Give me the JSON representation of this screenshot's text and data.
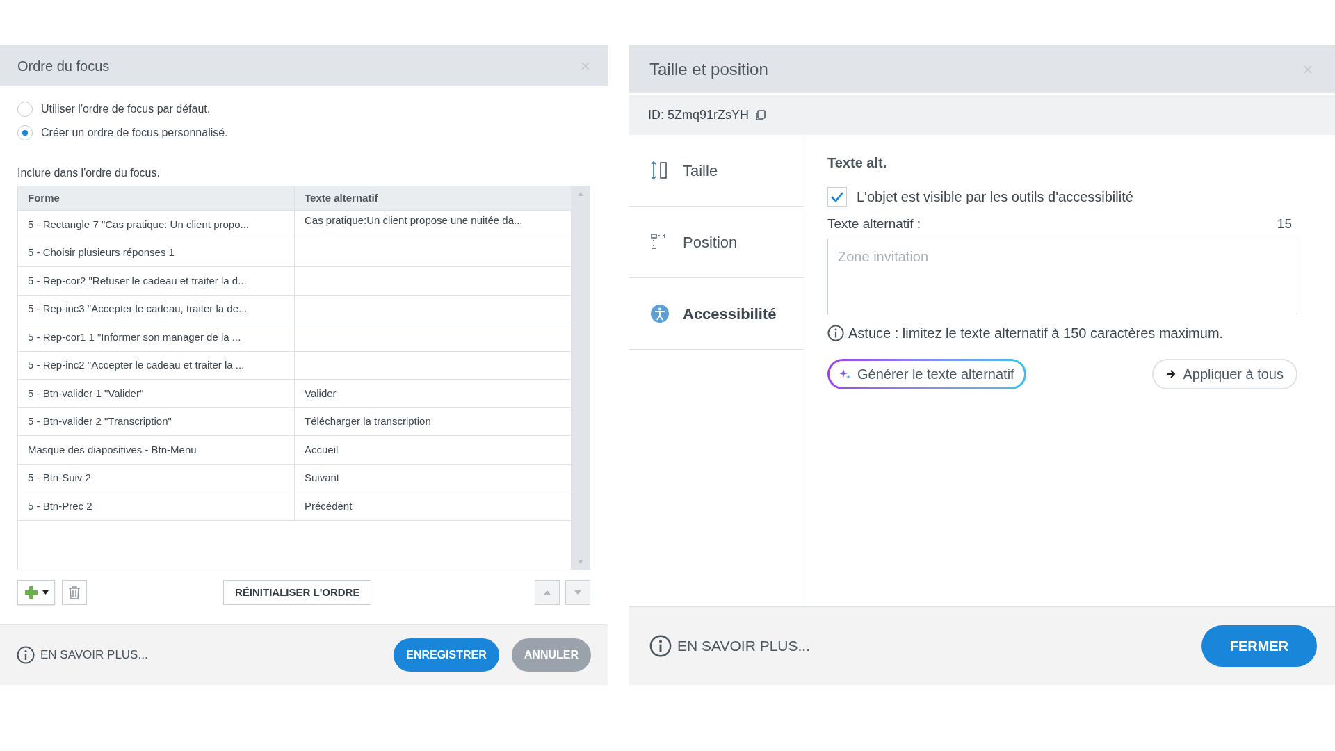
{
  "focus_dialog": {
    "title": "Ordre du focus",
    "radios": [
      {
        "label": "Utiliser l'ordre de focus par défaut.",
        "selected": false
      },
      {
        "label": "Créer un ordre de focus personnalisé.",
        "selected": true
      }
    ],
    "table_caption": "Inclure dans l'ordre du focus.",
    "table": {
      "columns": [
        "Forme",
        "Texte alternatif"
      ],
      "rows": [
        {
          "shape": "5 - Rectangle 7 \"Cas pratique: Un client propo...",
          "alt_text": "Cas pratique:Un client propose une nuitée da..."
        },
        {
          "shape": "5 - Choisir plusieurs réponses 1"
        },
        {
          "shape": "5 - Rep-cor2 \"Refuser le cadeau et traiter la d..."
        },
        {
          "shape": "5 - Rep-inc3 \"Accepter le cadeau, traiter la de..."
        },
        {
          "shape": "5 - Rep-cor1 1 \"Informer son manager  de la ..."
        },
        {
          "shape": "5 - Rep-inc2 \"Accepter le cadeau et traiter la ..."
        },
        {
          "shape": "5 - Btn-valider  1 \"Valider\"",
          "alt_text": "Valider"
        },
        {
          "shape": "5 - Btn-valider  2 \"Transcription\"",
          "alt_text": "Télécharger la transcription"
        },
        {
          "shape": "Masque des diapositives - Btn-Menu",
          "alt_text": "Accueil"
        },
        {
          "shape": "5 - Btn-Suiv 2",
          "alt_text": "Suivant"
        },
        {
          "shape": "5 - Btn-Prec 2",
          "alt_text": "Précédent"
        }
      ]
    },
    "reset_button": "RÉINITIALISER L'ORDRE",
    "learn_more": "EN SAVOIR PLUS...",
    "buttons": [
      {
        "label": "ENREGISTRER",
        "kind": "primary"
      },
      {
        "label": "ANNULER",
        "kind": "secondary"
      }
    ]
  },
  "size_dialog": {
    "title": "Taille et position",
    "id_label": "ID: 5Zmq91rZsYH",
    "tabs": [
      {
        "label": "Taille",
        "kind": "size",
        "selected": false
      },
      {
        "label": "Position",
        "kind": "position",
        "selected": false
      },
      {
        "label": "Accessibilité",
        "kind": "accessibility",
        "selected": true
      }
    ],
    "section_title": "Texte alt.",
    "visible_checkbox": {
      "label": "L'objet est visible par les outils d'accessibilité",
      "checked": true
    },
    "alt_label": "Texte alternatif :",
    "alt_count": "15",
    "alt_placeholder": "Zone invitation",
    "tip": "Astuce : limitez le texte alternatif à 150 caractères maximum.",
    "generate_button": "Générer le texte alternatif",
    "apply_button": "Appliquer à tous",
    "learn_more": "EN SAVOIR PLUS...",
    "close_button": "FERMER"
  }
}
